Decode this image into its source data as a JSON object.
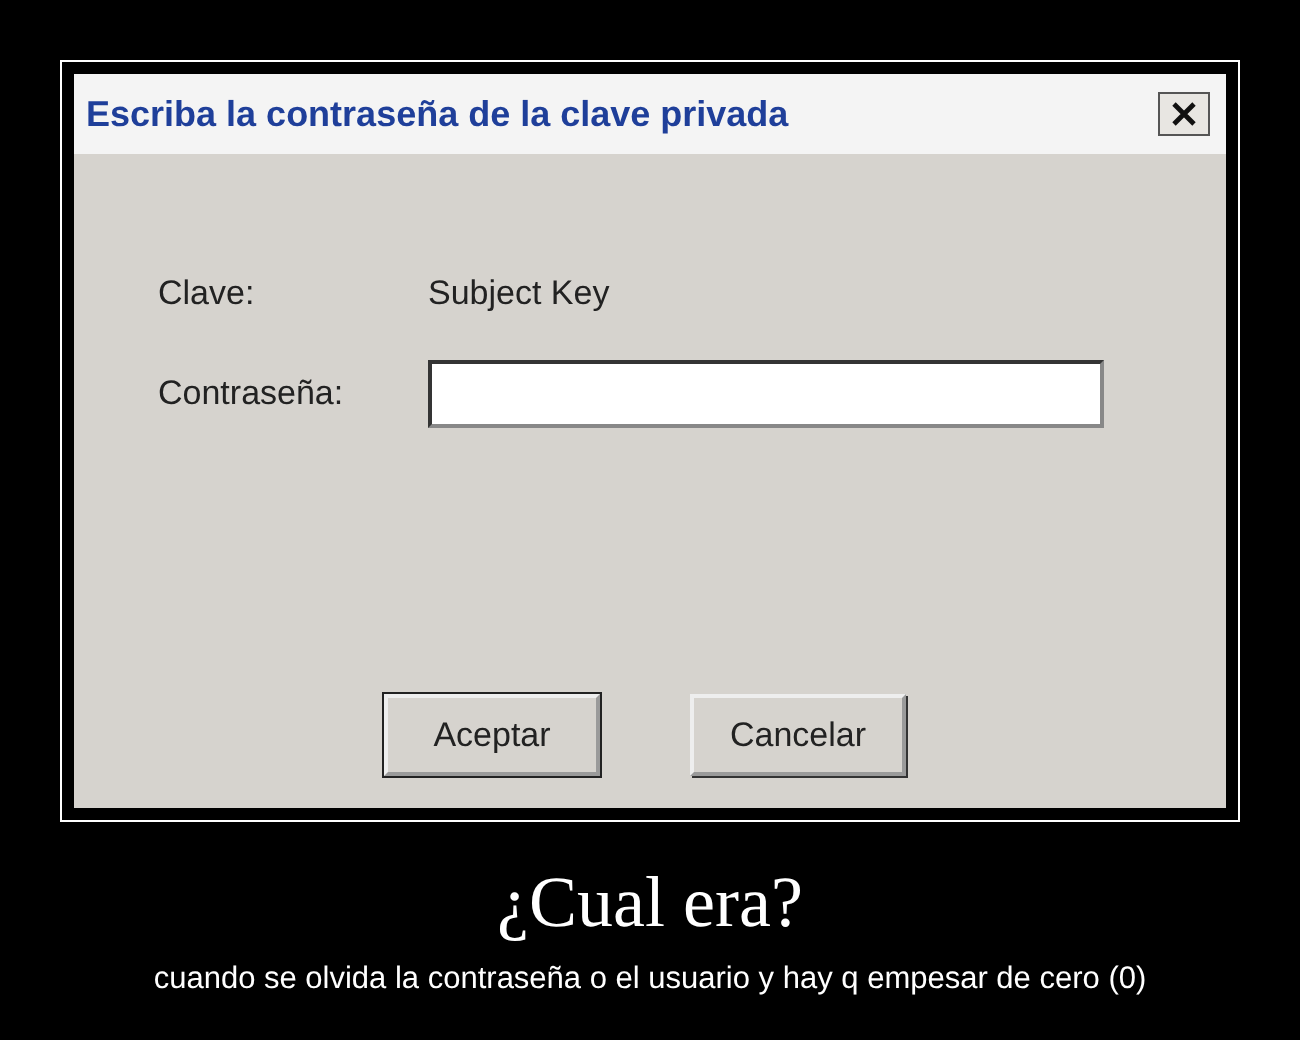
{
  "dialog": {
    "title": "Escriba la contraseña de la clave privada",
    "fields": [
      {
        "kind": "text",
        "label": "Clave:",
        "value": "Subject Key"
      },
      {
        "kind": "input",
        "label": "Contraseña:"
      }
    ],
    "buttons": [
      "Aceptar",
      "Cancelar"
    ]
  },
  "caption": {
    "title": "¿Cual era?",
    "subtitle": "cuando se olvida la contraseña o el usuario y hay q empesar de cero (0)"
  }
}
